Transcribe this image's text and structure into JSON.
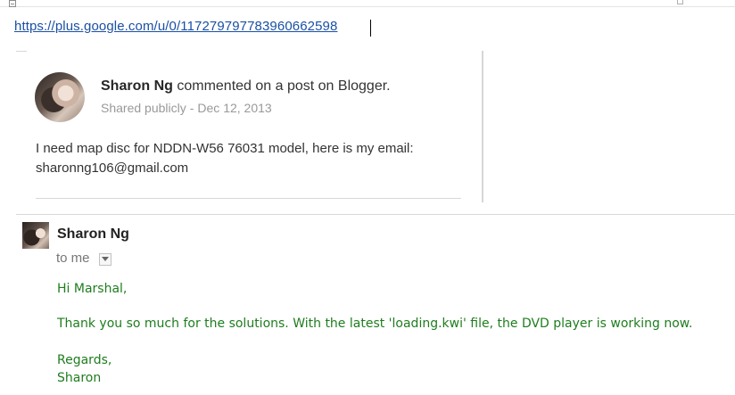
{
  "url": "https://plus.google.com/u/0/117279797783960662598",
  "post": {
    "author": "Sharon Ng",
    "action": "commented on a post on Blogger.",
    "visibility": "Shared publicly",
    "separator": "-",
    "date": "Dec 12, 2013",
    "body": "I need map disc for NDDN-W56 76031 model, here is my email: sharonng106@gmail.com"
  },
  "email": {
    "sender": "Sharon Ng",
    "recipient": "to me",
    "greeting": "Hi Marshal,",
    "message": "Thank you so much for the solutions. With the latest 'loading.kwi' file, the DVD player is working now.",
    "signoff": "Regards,",
    "signature": "Sharon",
    "text_color": "#1e7d1e"
  },
  "colors": {
    "link": "#1a50a3",
    "meta_text": "#999999"
  },
  "icons": {
    "recipient_dropdown": "chevron-down-icon"
  }
}
